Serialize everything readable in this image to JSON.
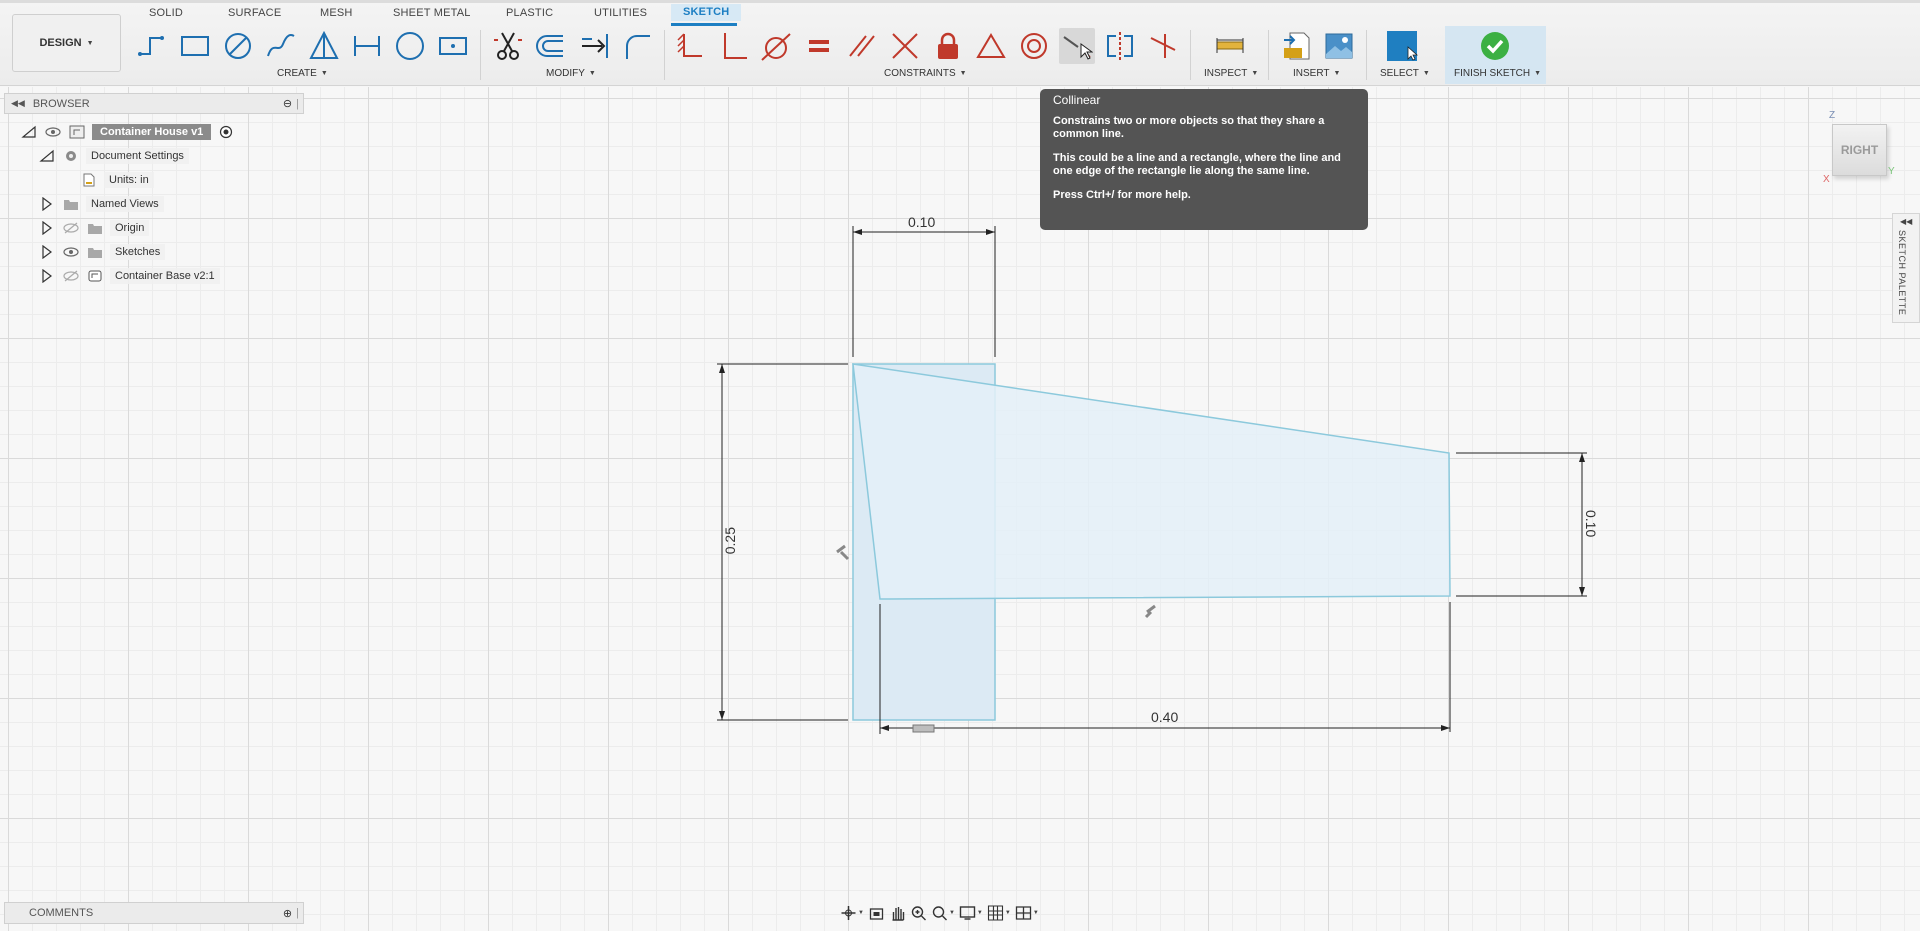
{
  "workspace": {
    "label": "DESIGN"
  },
  "tabs": [
    {
      "label": "SOLID"
    },
    {
      "label": "SURFACE"
    },
    {
      "label": "MESH"
    },
    {
      "label": "SHEET METAL"
    },
    {
      "label": "PLASTIC"
    },
    {
      "label": "UTILITIES"
    },
    {
      "label": "SKETCH"
    }
  ],
  "groups": {
    "create": "CREATE",
    "modify": "MODIFY",
    "constraints": "CONSTRAINTS",
    "inspect": "INSPECT",
    "insert": "INSERT",
    "select": "SELECT",
    "finish": "FINISH SKETCH"
  },
  "browser": {
    "title": "BROWSER",
    "items": [
      {
        "label": "Container House v1"
      },
      {
        "label": "Document Settings"
      },
      {
        "label": "Units: in"
      },
      {
        "label": "Named Views"
      },
      {
        "label": "Origin"
      },
      {
        "label": "Sketches"
      },
      {
        "label": "Container Base v2:1"
      }
    ]
  },
  "tooltip": {
    "title": "Collinear",
    "line1": "Constrains two or more objects so that they share a common line.",
    "line2": "This could be a line and a rectangle, where the line and one edge of the rectangle lie along the same line.",
    "line3": "Press Ctrl+/ for more help."
  },
  "viewcube": {
    "face": "RIGHT",
    "axis_z": "Z",
    "axis_x": "X",
    "axis_y": "Y"
  },
  "sketch_palette": {
    "label": "SKETCH PALETTE"
  },
  "dimensions": {
    "top_width": "0.10",
    "left_height": "0.25",
    "right_height": "0.10",
    "bottom_length": "0.40"
  },
  "comments": {
    "label": "COMMENTS"
  },
  "colors": {
    "accent": "#1d7fc3",
    "sketch_line": "#8ccbe0",
    "profile_fill": "#dcebf5",
    "tooltip_bg": "#545454",
    "finish_check": "#3cb043"
  }
}
